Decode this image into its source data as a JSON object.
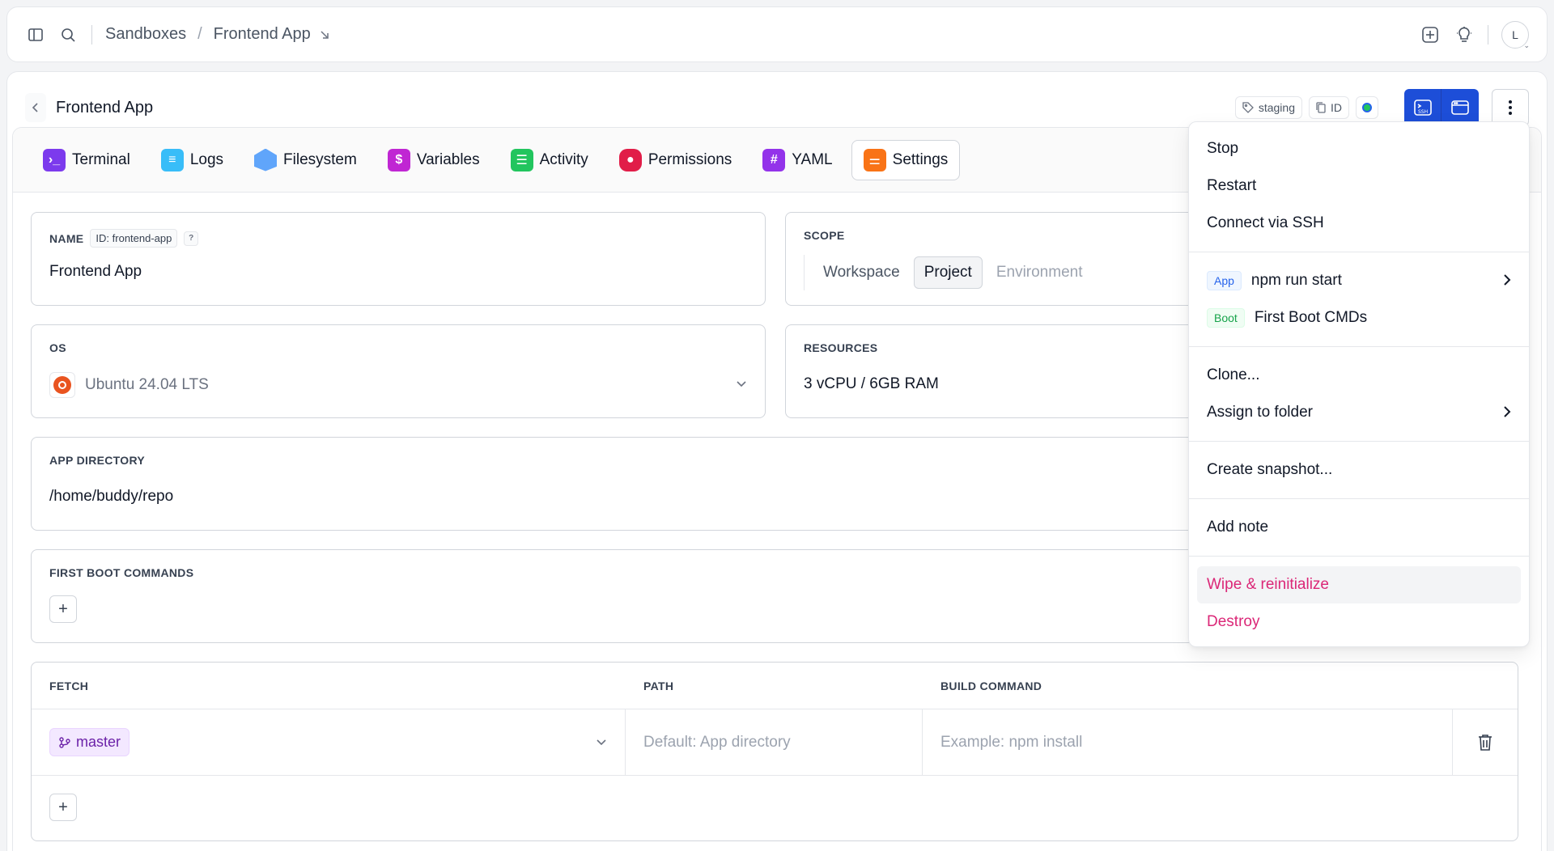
{
  "topbar": {
    "breadcrumbs": [
      "Sandboxes",
      "Frontend App"
    ],
    "breadcrumb_sep": "/",
    "avatar_initial": "L"
  },
  "header": {
    "title": "Frontend App",
    "tag_label": "staging",
    "id_label": "ID",
    "status_color": "#22c55e"
  },
  "tabs": [
    {
      "label": "Terminal",
      "icon": "terminal-icon",
      "color": "#7c3aed"
    },
    {
      "label": "Logs",
      "icon": "logs-icon",
      "color": "#38bdf8"
    },
    {
      "label": "Filesystem",
      "icon": "filesystem-icon",
      "color": "#60a5fa"
    },
    {
      "label": "Variables",
      "icon": "variables-icon",
      "color": "#c026d3"
    },
    {
      "label": "Activity",
      "icon": "activity-icon",
      "color": "#22c55e"
    },
    {
      "label": "Permissions",
      "icon": "lock-icon",
      "color": "#e11d48"
    },
    {
      "label": "YAML",
      "icon": "hash-icon",
      "color": "#9333ea"
    },
    {
      "label": "Settings",
      "icon": "toggles-icon",
      "color": "#f97316"
    }
  ],
  "settings": {
    "name": {
      "label": "NAME",
      "id_chip": "ID: frontend-app",
      "help": "?",
      "value": "Frontend App"
    },
    "scope": {
      "label": "SCOPE",
      "options": [
        "Workspace",
        "Project",
        "Environment"
      ],
      "selected": "Project"
    },
    "os": {
      "label": "OS",
      "value": "Ubuntu 24.04 LTS"
    },
    "resources": {
      "label": "RESOURCES",
      "value": "3 vCPU / 6GB RAM"
    },
    "app_directory": {
      "label": "APP DIRECTORY",
      "value": "/home/buddy/repo"
    },
    "first_boot": {
      "label": "FIRST BOOT COMMANDS"
    },
    "fetch": {
      "headers": [
        "FETCH",
        "PATH",
        "BUILD COMMAND"
      ],
      "branch": "master",
      "path_placeholder": "Default: App directory",
      "build_placeholder": "Example: npm install"
    }
  },
  "menu": {
    "stop": "Stop",
    "restart": "Restart",
    "ssh": "Connect via SSH",
    "app_tag": "App",
    "app_cmd": "npm run start",
    "boot_tag": "Boot",
    "boot_cmd": "First Boot CMDs",
    "clone": "Clone...",
    "assign": "Assign to folder",
    "snapshot": "Create snapshot...",
    "note": "Add note",
    "wipe": "Wipe & reinitialize",
    "destroy": "Destroy",
    "danger_color": "#db2777"
  },
  "accent_color": "#1d4ed8"
}
